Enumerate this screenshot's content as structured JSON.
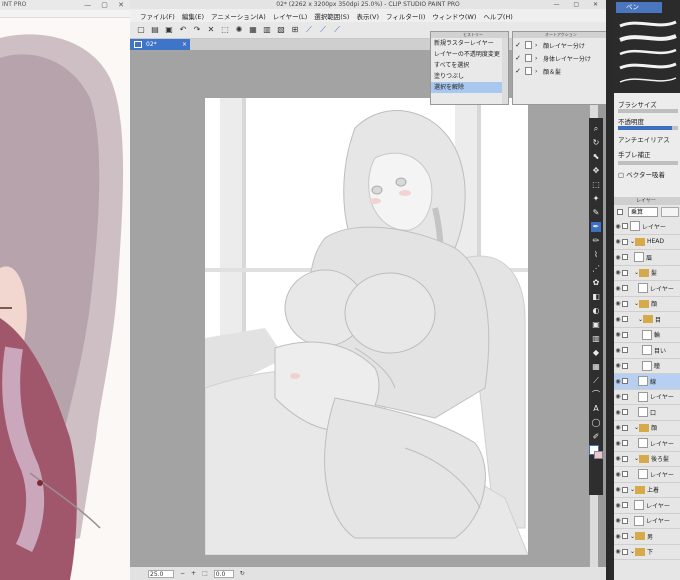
{
  "reference_window": {
    "title": "INT PRO",
    "controls": "— ▢ ✕"
  },
  "main_window": {
    "title": "02* (2262 x 3200px 350dpi 25.0%) - CLIP STUDIO PAINT PRO",
    "controls": "— ▢ ✕"
  },
  "menu": [
    "ファイル(F)",
    "編集(E)",
    "アニメーション(A)",
    "レイヤー(L)",
    "選択範囲(S)",
    "表示(V)",
    "フィルター(I)",
    "ウィンドウ(W)",
    "ヘルプ(H)"
  ],
  "tabs": [
    {
      "label": "02*",
      "close": "×"
    }
  ],
  "status": {
    "zoom": "25.0",
    "angle": "0.0"
  },
  "history": {
    "title": "ヒストリー",
    "items": [
      "新規ラスターレイヤー",
      "レイヤーの不透明度変更",
      "すべてを選択",
      "塗りつぶし",
      "選択を解除"
    ],
    "selected_index": 4
  },
  "auto_action": {
    "title": "オートアクション",
    "items": [
      {
        "label": "顔レイヤー分け",
        "checked": true
      },
      {
        "label": "身体レイヤー分け",
        "checked": true
      },
      {
        "label": "顔＆髪",
        "checked": true
      }
    ]
  },
  "brush_panel": {
    "tab_label": "ペン"
  },
  "tool_property": {
    "brush_size_label": "ブラシサイズ",
    "opacity_label": "不透明度",
    "antialias_label": "アンチエイリアス",
    "stabilization_label": "手ブレ補正",
    "vector_snap_label": "ベクター吸着",
    "opacity_value": 0.9
  },
  "layer_panel": {
    "title": "レイヤー",
    "blend_mode": "乗算",
    "layers": [
      {
        "name": "レイヤー",
        "type": "raster",
        "indent": 0
      },
      {
        "name": "HEAD",
        "type": "folder",
        "indent": 0
      },
      {
        "name": "眉",
        "type": "raster",
        "indent": 1
      },
      {
        "name": "髪",
        "type": "folder",
        "indent": 1
      },
      {
        "name": "レイヤー",
        "type": "raster",
        "indent": 2
      },
      {
        "name": "顔",
        "type": "folder",
        "indent": 1
      },
      {
        "name": "目",
        "type": "folder",
        "indent": 2
      },
      {
        "name": "輪",
        "type": "raster",
        "indent": 3
      },
      {
        "name": "目い",
        "type": "raster",
        "indent": 3
      },
      {
        "name": "瞳",
        "type": "raster",
        "indent": 3
      },
      {
        "name": "線",
        "type": "raster",
        "indent": 2,
        "selected": true
      },
      {
        "name": "レイヤー",
        "type": "raster",
        "indent": 2
      },
      {
        "name": "口",
        "type": "raster",
        "indent": 2
      },
      {
        "name": "顔",
        "type": "folder",
        "indent": 1
      },
      {
        "name": "レイヤー",
        "type": "raster",
        "indent": 2
      },
      {
        "name": "後ろ髪",
        "type": "folder",
        "indent": 1
      },
      {
        "name": "レイヤー",
        "type": "raster",
        "indent": 2
      },
      {
        "name": "上着",
        "type": "folder",
        "indent": 0
      },
      {
        "name": "レイヤー",
        "type": "raster",
        "indent": 1
      },
      {
        "name": "レイヤー",
        "type": "raster",
        "indent": 1
      },
      {
        "name": "男",
        "type": "folder",
        "indent": 0
      },
      {
        "name": "下",
        "type": "folder",
        "indent": 0
      }
    ]
  }
}
